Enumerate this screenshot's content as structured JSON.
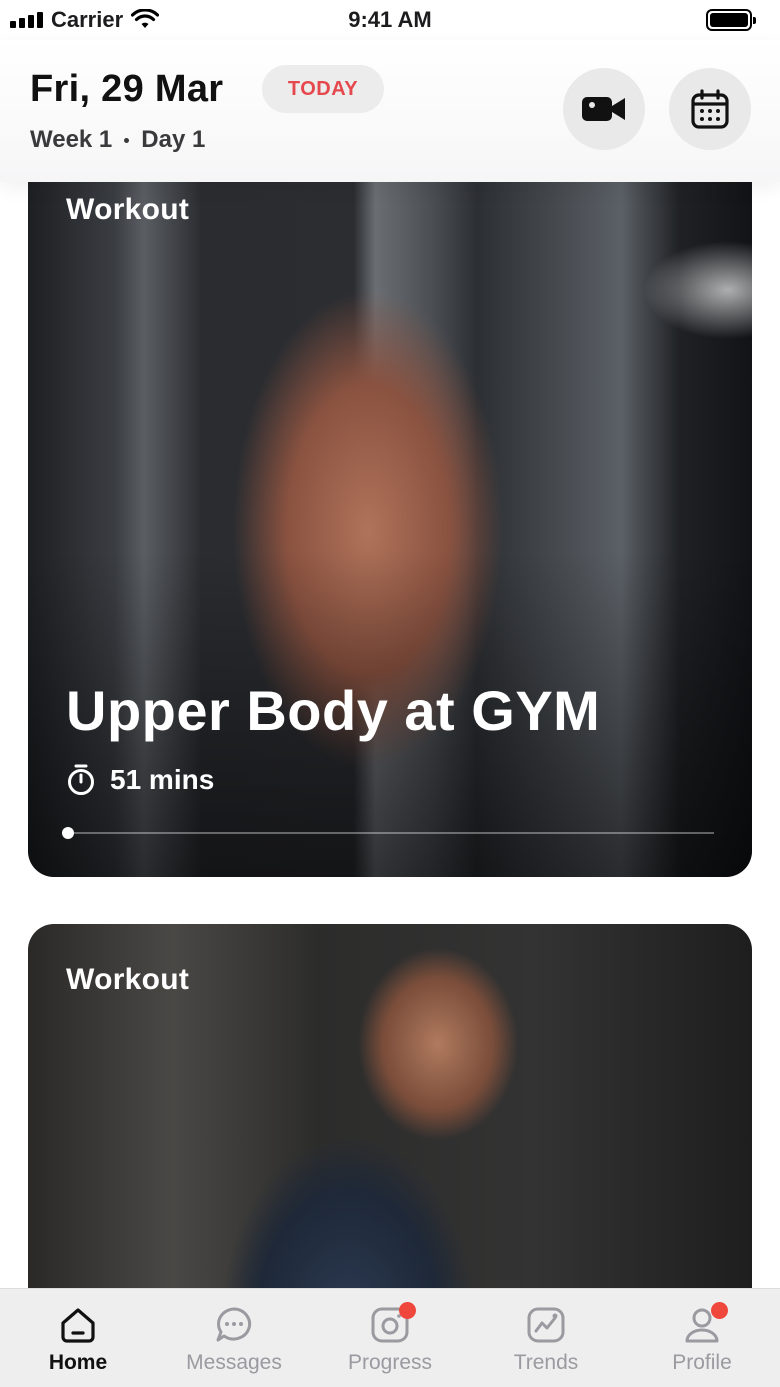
{
  "status_bar": {
    "carrier": "Carrier",
    "time": "9:41 AM"
  },
  "header": {
    "date": "Fri, 29 Mar",
    "today_badge": "TODAY",
    "week": "Week 1",
    "day": "Day 1",
    "buttons": [
      {
        "icon": "video-camera-icon"
      },
      {
        "icon": "calendar-icon"
      }
    ]
  },
  "cards": [
    {
      "label": "Workout",
      "title": "Upper Body at GYM",
      "duration": "51 mins",
      "progress": 0.0,
      "image": "muscular man posing in gym"
    },
    {
      "label": "Workout",
      "image": "smiling woman in gym"
    }
  ],
  "tabbar": {
    "active": "home",
    "tabs": [
      {
        "id": "home",
        "label": "Home",
        "icon": "home-icon",
        "badge": false
      },
      {
        "id": "messages",
        "label": "Messages",
        "icon": "chat-bubble-icon",
        "badge": false
      },
      {
        "id": "progress",
        "label": "Progress",
        "icon": "camera-progress-icon",
        "badge": true
      },
      {
        "id": "trends",
        "label": "Trends",
        "icon": "trend-chart-icon",
        "badge": false
      },
      {
        "id": "profile",
        "label": "Profile",
        "icon": "user-icon",
        "badge": true
      }
    ]
  },
  "colors": {
    "accent_red": "#e5484d",
    "badge_red": "#f0473c",
    "tab_inactive": "#9a9aa0",
    "tab_active": "#111111"
  }
}
